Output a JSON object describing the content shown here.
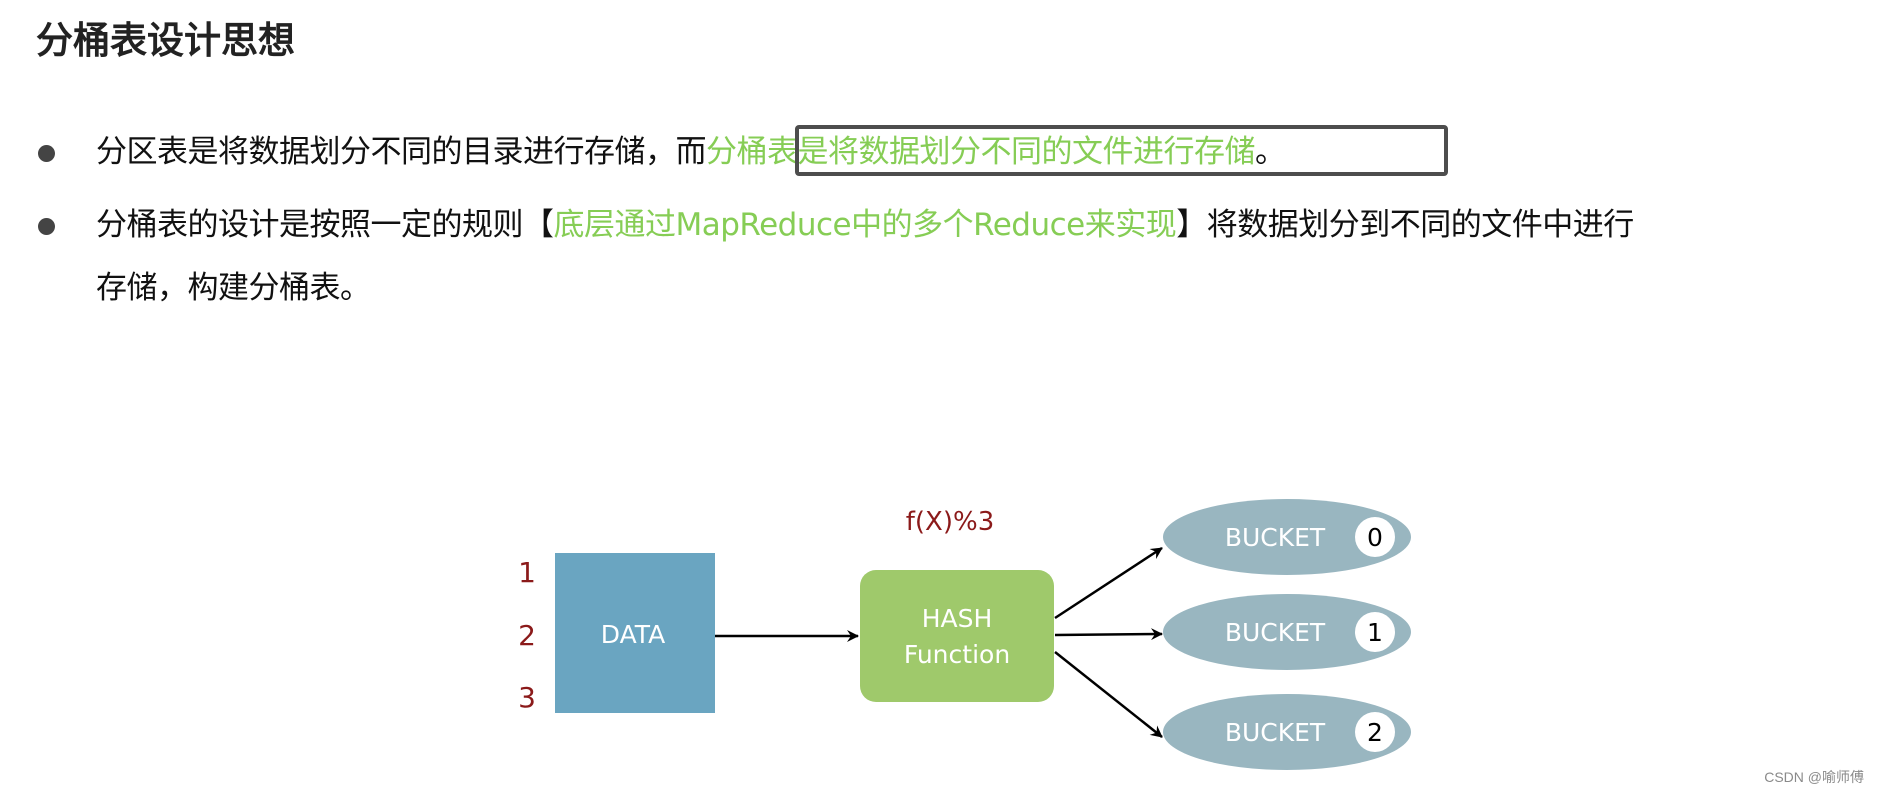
{
  "title": "分桶表设计思想",
  "bullets": [
    {
      "line1_plain": "分区表是将数据划分不同的目录进行存储，而",
      "line1_green": "分桶表是将数据划分不同的文件进行存储",
      "line1_end": "。"
    },
    {
      "line1_a": "分桶表的设计是按照一定的规则【",
      "line1_green": "底层通过MapReduce中的多个Reduce来实现",
      "line1_b": "】将数据划分到不同的文件中进行",
      "line2": "存储，构建分桶表。"
    }
  ],
  "diagram": {
    "row_labels": [
      "1",
      "2",
      "3"
    ],
    "data_label": "DATA",
    "hash_label_line1": "HASH",
    "hash_label_line2": "Function",
    "formula": "f(X)%3",
    "buckets": [
      {
        "label": "BUCKET",
        "number": "0"
      },
      {
        "label": "BUCKET",
        "number": "1"
      },
      {
        "label": "BUCKET",
        "number": "2"
      }
    ],
    "colors": {
      "data_box": "#6aa5c1",
      "hash_box": "#9fc96b",
      "bucket": "#99b6c0",
      "label_red": "#8b1a1a",
      "highlight_green": "#86cd55"
    }
  },
  "watermark": "CSDN @喻师傅"
}
